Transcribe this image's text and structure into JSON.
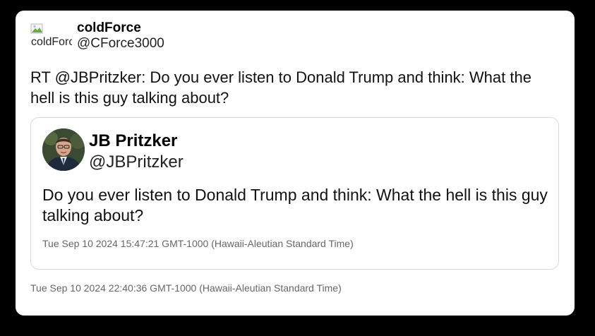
{
  "tweet": {
    "author": {
      "display_name": "coldForce",
      "handle": "@CForce3000",
      "avatar_alt": "coldForce"
    },
    "text": "RT @JBPritzker: Do you ever listen to Donald Trump and think: What the hell is this guy talking about?",
    "timestamp": "Tue Sep 10 2024 22:40:36 GMT-1000 (Hawaii-Aleutian Standard Time)"
  },
  "quoted_tweet": {
    "author": {
      "display_name": "JB Pritzker",
      "handle": "@JBPritzker"
    },
    "text": "Do you ever listen to Donald Trump and think: What the hell is this guy talking about?",
    "timestamp": "Tue Sep 10 2024 15:47:21 GMT-1000 (Hawaii-Aleutian Standard Time)"
  },
  "colors": {
    "background": "#000000",
    "card": "#ffffff",
    "border": "#d8d8d8",
    "muted_text": "#666666"
  }
}
